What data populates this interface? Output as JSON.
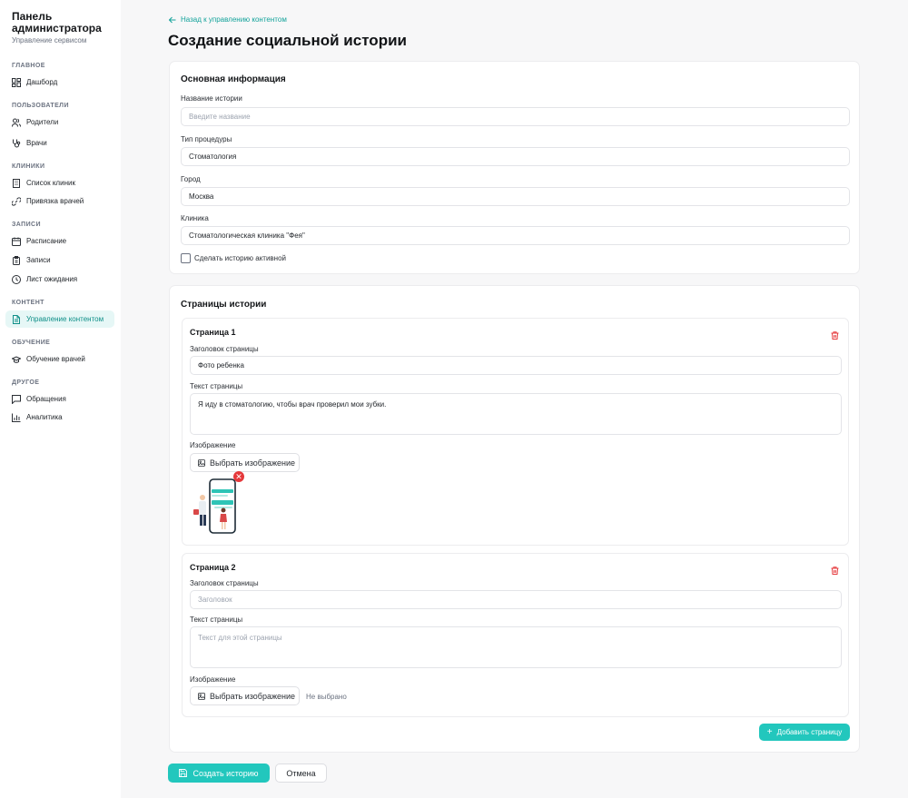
{
  "sidebar": {
    "title": "Панель администратора",
    "subtitle": "Управление сервисом",
    "sections": {
      "main": "ГЛАВНОЕ",
      "users": "ПОЛЬЗОВАТЕЛИ",
      "clinics": "КЛИНИКИ",
      "records": "ЗАПИСИ",
      "content": "КОНТЕНТ",
      "training": "ОБУЧЕНИЕ",
      "other": "ДРУГОЕ"
    },
    "items": {
      "dashboard": "Дашборд",
      "parents": "Родители",
      "doctors": "Врачи",
      "clinic_list": "Список клиник",
      "doctor_binding": "Привязка врачей",
      "schedule": "Расписание",
      "appointments": "Записи",
      "waitlist": "Лист ожидания",
      "content_management": "Управление контентом",
      "doctor_training": "Обучение врачей",
      "requests": "Обращения",
      "analytics": "Аналитика"
    },
    "active_item": "content_management"
  },
  "header": {
    "back_link": "Назад к управлению контентом",
    "title": "Создание социальной истории"
  },
  "basic_info": {
    "title": "Основная информация",
    "story_name_label": "Название истории",
    "story_name_placeholder": "Введите название",
    "procedure_type_label": "Тип процедуры",
    "procedure_type_value": "Стоматология",
    "city_label": "Город",
    "city_value": "Москва",
    "clinic_label": "Клиника",
    "clinic_value": "Стоматологическая клиника \"Фея\"",
    "active_checkbox_label": "Сделать историю активной",
    "active_checked": false
  },
  "pages_section": {
    "title": "Страницы истории",
    "pages": [
      {
        "title": "Страница 1",
        "heading_label": "Заголовок страницы",
        "heading_value": "Фото ребенка",
        "text_label": "Текст страницы",
        "text_value": "Я иду в стоматологию, чтобы врач проверил мои зубки.",
        "image_label": "Изображение",
        "pick_image_label": "Выбрать изображение"
      },
      {
        "title": "Страница 2",
        "heading_label": "Заголовок страницы",
        "heading_placeholder": "Заголовок",
        "text_label": "Текст страницы",
        "text_placeholder": "Текст для этой страницы",
        "image_label": "Изображение",
        "pick_image_label": "Выбрать изображение",
        "no_file_text": "Не выбрано"
      }
    ],
    "add_page_label": "Добавить страницу"
  },
  "actions": {
    "create_label": "Создать историю",
    "cancel_label": "Отмена"
  },
  "colors": {
    "accent": "#22c7bd",
    "accent_text": "#14a39b",
    "danger": "#e5383b",
    "active_bg": "#e6f7f6"
  }
}
